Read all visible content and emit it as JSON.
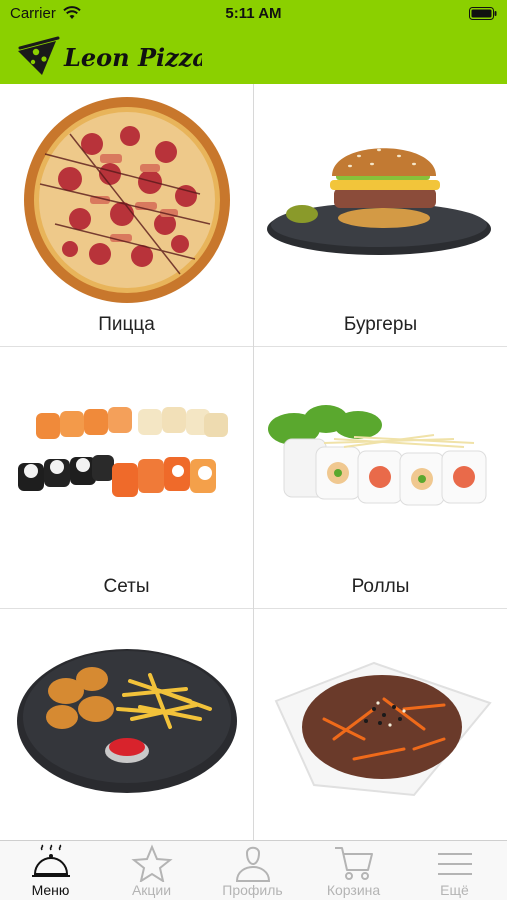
{
  "status_bar": {
    "carrier": "Carrier",
    "time": "5:11 AM"
  },
  "header": {
    "logo_text": "Leon Pizza",
    "background_color": "#8bd000"
  },
  "menu": {
    "categories": [
      {
        "label": "Пицца",
        "icon": "pizza-photo"
      },
      {
        "label": "Бургеры",
        "icon": "burger-photo"
      },
      {
        "label": "Сеты",
        "icon": "sushi-set-photo"
      },
      {
        "label": "Роллы",
        "icon": "rolls-photo"
      },
      {
        "label": "",
        "icon": "nuggets-fries-photo"
      },
      {
        "label": "",
        "icon": "noodles-photo"
      }
    ]
  },
  "tab_bar": {
    "active_index": 0,
    "tabs": [
      {
        "label": "Меню",
        "icon": "cloche-icon"
      },
      {
        "label": "Акции",
        "icon": "star-icon"
      },
      {
        "label": "Профиль",
        "icon": "person-icon"
      },
      {
        "label": "Корзина",
        "icon": "cart-icon"
      },
      {
        "label": "Ещё",
        "icon": "menu-icon"
      }
    ]
  }
}
